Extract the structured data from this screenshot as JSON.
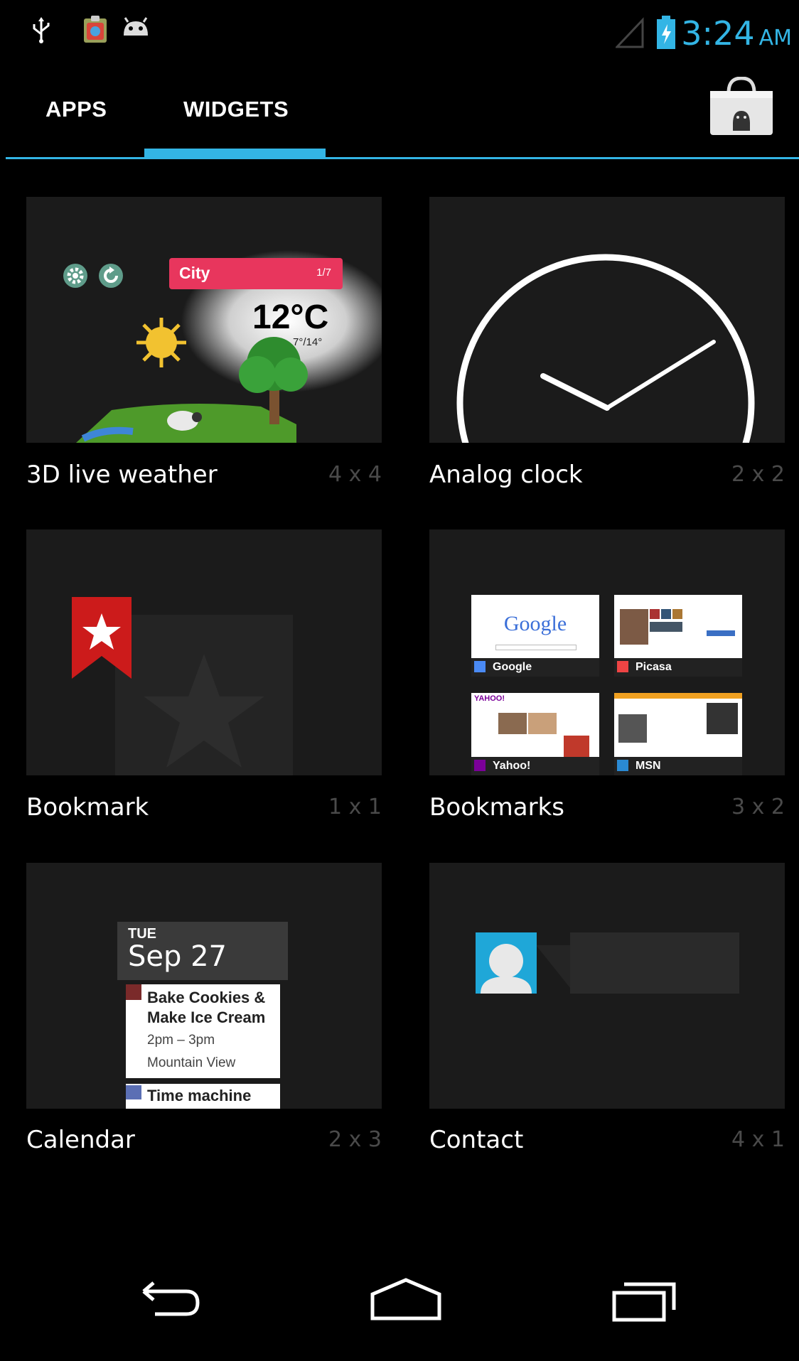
{
  "status_bar": {
    "time": "3:24",
    "ampm": "AM",
    "icons": [
      "usb-icon",
      "app-notification-icon",
      "android-debug-icon",
      "signal-icon",
      "battery-charging-icon"
    ]
  },
  "tabs": {
    "apps_label": "APPS",
    "widgets_label": "WIDGETS",
    "selected": "WIDGETS"
  },
  "accent_color": "#33b5e5",
  "widgets": [
    {
      "name": "3D live weather",
      "size": "4 x 4",
      "preview": {
        "city": "City",
        "page": "1/7",
        "temp": "12°C",
        "range": "7°/14°"
      }
    },
    {
      "name": "Analog clock",
      "size": "2 x 2"
    },
    {
      "name": "Bookmark",
      "size": "1 x 1"
    },
    {
      "name": "Bookmarks",
      "size": "3 x 2",
      "preview": {
        "google_logo": "Google",
        "items": [
          "Google",
          "Picasa",
          "Yahoo!",
          "MSN"
        ],
        "yahoo_logo": "YAHOO!"
      }
    },
    {
      "name": "Calendar",
      "size": "2 x 3",
      "preview": {
        "day": "TUE",
        "date": "Sep 27",
        "event1_title_line1": "Bake Cookies &",
        "event1_title_line2": "Make Ice Cream",
        "event1_time": "2pm – 3pm",
        "event1_location": "Mountain View",
        "event2_title": "Time machine"
      }
    },
    {
      "name": "Contact",
      "size": "4 x 1"
    }
  ],
  "nav": {
    "icons": [
      "back-icon",
      "home-icon",
      "recents-icon"
    ]
  }
}
